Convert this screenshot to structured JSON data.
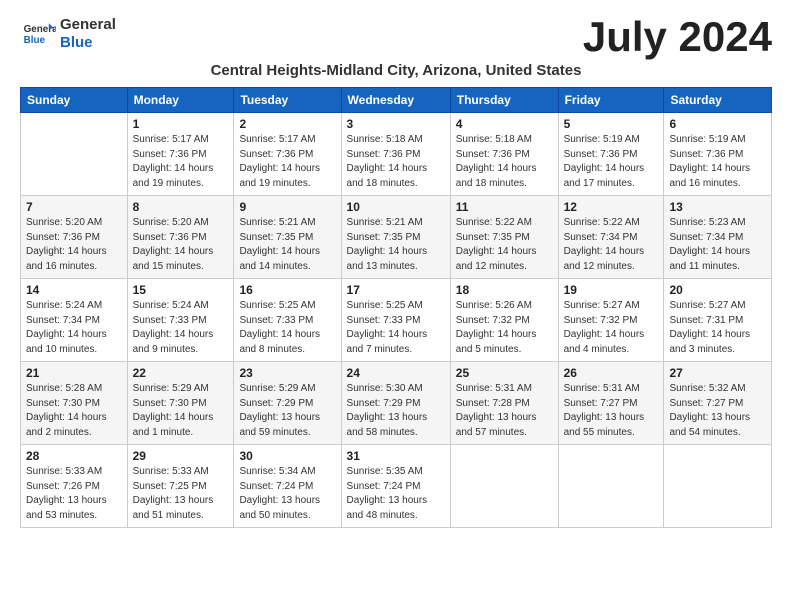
{
  "header": {
    "logo_line1": "General",
    "logo_line2": "Blue",
    "title": "July 2024",
    "location": "Central Heights-Midland City, Arizona, United States"
  },
  "weekdays": [
    "Sunday",
    "Monday",
    "Tuesday",
    "Wednesday",
    "Thursday",
    "Friday",
    "Saturday"
  ],
  "weeks": [
    [
      {
        "day": "",
        "info": ""
      },
      {
        "day": "1",
        "info": "Sunrise: 5:17 AM\nSunset: 7:36 PM\nDaylight: 14 hours\nand 19 minutes."
      },
      {
        "day": "2",
        "info": "Sunrise: 5:17 AM\nSunset: 7:36 PM\nDaylight: 14 hours\nand 19 minutes."
      },
      {
        "day": "3",
        "info": "Sunrise: 5:18 AM\nSunset: 7:36 PM\nDaylight: 14 hours\nand 18 minutes."
      },
      {
        "day": "4",
        "info": "Sunrise: 5:18 AM\nSunset: 7:36 PM\nDaylight: 14 hours\nand 18 minutes."
      },
      {
        "day": "5",
        "info": "Sunrise: 5:19 AM\nSunset: 7:36 PM\nDaylight: 14 hours\nand 17 minutes."
      },
      {
        "day": "6",
        "info": "Sunrise: 5:19 AM\nSunset: 7:36 PM\nDaylight: 14 hours\nand 16 minutes."
      }
    ],
    [
      {
        "day": "7",
        "info": "Sunrise: 5:20 AM\nSunset: 7:36 PM\nDaylight: 14 hours\nand 16 minutes."
      },
      {
        "day": "8",
        "info": "Sunrise: 5:20 AM\nSunset: 7:36 PM\nDaylight: 14 hours\nand 15 minutes."
      },
      {
        "day": "9",
        "info": "Sunrise: 5:21 AM\nSunset: 7:35 PM\nDaylight: 14 hours\nand 14 minutes."
      },
      {
        "day": "10",
        "info": "Sunrise: 5:21 AM\nSunset: 7:35 PM\nDaylight: 14 hours\nand 13 minutes."
      },
      {
        "day": "11",
        "info": "Sunrise: 5:22 AM\nSunset: 7:35 PM\nDaylight: 14 hours\nand 12 minutes."
      },
      {
        "day": "12",
        "info": "Sunrise: 5:22 AM\nSunset: 7:34 PM\nDaylight: 14 hours\nand 12 minutes."
      },
      {
        "day": "13",
        "info": "Sunrise: 5:23 AM\nSunset: 7:34 PM\nDaylight: 14 hours\nand 11 minutes."
      }
    ],
    [
      {
        "day": "14",
        "info": "Sunrise: 5:24 AM\nSunset: 7:34 PM\nDaylight: 14 hours\nand 10 minutes."
      },
      {
        "day": "15",
        "info": "Sunrise: 5:24 AM\nSunset: 7:33 PM\nDaylight: 14 hours\nand 9 minutes."
      },
      {
        "day": "16",
        "info": "Sunrise: 5:25 AM\nSunset: 7:33 PM\nDaylight: 14 hours\nand 8 minutes."
      },
      {
        "day": "17",
        "info": "Sunrise: 5:25 AM\nSunset: 7:33 PM\nDaylight: 14 hours\nand 7 minutes."
      },
      {
        "day": "18",
        "info": "Sunrise: 5:26 AM\nSunset: 7:32 PM\nDaylight: 14 hours\nand 5 minutes."
      },
      {
        "day": "19",
        "info": "Sunrise: 5:27 AM\nSunset: 7:32 PM\nDaylight: 14 hours\nand 4 minutes."
      },
      {
        "day": "20",
        "info": "Sunrise: 5:27 AM\nSunset: 7:31 PM\nDaylight: 14 hours\nand 3 minutes."
      }
    ],
    [
      {
        "day": "21",
        "info": "Sunrise: 5:28 AM\nSunset: 7:30 PM\nDaylight: 14 hours\nand 2 minutes."
      },
      {
        "day": "22",
        "info": "Sunrise: 5:29 AM\nSunset: 7:30 PM\nDaylight: 14 hours\nand 1 minute."
      },
      {
        "day": "23",
        "info": "Sunrise: 5:29 AM\nSunset: 7:29 PM\nDaylight: 13 hours\nand 59 minutes."
      },
      {
        "day": "24",
        "info": "Sunrise: 5:30 AM\nSunset: 7:29 PM\nDaylight: 13 hours\nand 58 minutes."
      },
      {
        "day": "25",
        "info": "Sunrise: 5:31 AM\nSunset: 7:28 PM\nDaylight: 13 hours\nand 57 minutes."
      },
      {
        "day": "26",
        "info": "Sunrise: 5:31 AM\nSunset: 7:27 PM\nDaylight: 13 hours\nand 55 minutes."
      },
      {
        "day": "27",
        "info": "Sunrise: 5:32 AM\nSunset: 7:27 PM\nDaylight: 13 hours\nand 54 minutes."
      }
    ],
    [
      {
        "day": "28",
        "info": "Sunrise: 5:33 AM\nSunset: 7:26 PM\nDaylight: 13 hours\nand 53 minutes."
      },
      {
        "day": "29",
        "info": "Sunrise: 5:33 AM\nSunset: 7:25 PM\nDaylight: 13 hours\nand 51 minutes."
      },
      {
        "day": "30",
        "info": "Sunrise: 5:34 AM\nSunset: 7:24 PM\nDaylight: 13 hours\nand 50 minutes."
      },
      {
        "day": "31",
        "info": "Sunrise: 5:35 AM\nSunset: 7:24 PM\nDaylight: 13 hours\nand 48 minutes."
      },
      {
        "day": "",
        "info": ""
      },
      {
        "day": "",
        "info": ""
      },
      {
        "day": "",
        "info": ""
      }
    ]
  ]
}
